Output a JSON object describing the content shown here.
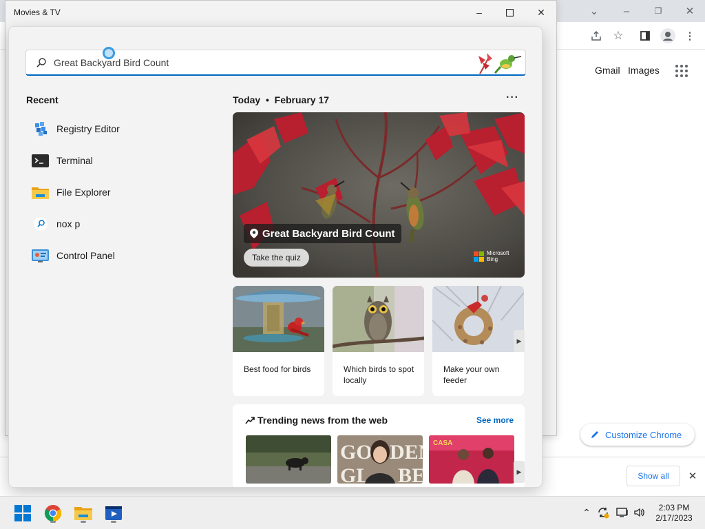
{
  "window": {
    "title": "Movies & TV"
  },
  "chrome": {
    "gmail": "Gmail",
    "images": "Images",
    "customize": "Customize Chrome",
    "show_all": "Show all"
  },
  "search": {
    "query": "Great Backyard Bird Count"
  },
  "recent": {
    "heading": "Recent",
    "items": [
      {
        "label": "Registry Editor",
        "icon": "registry-editor-icon"
      },
      {
        "label": "Terminal",
        "icon": "terminal-icon"
      },
      {
        "label": "File Explorer",
        "icon": "folder-icon"
      },
      {
        "label": "nox p",
        "icon": "search-icon"
      },
      {
        "label": "Control Panel",
        "icon": "control-panel-icon"
      }
    ]
  },
  "today": {
    "label": "Today",
    "date": "February 17"
  },
  "hero": {
    "title": "Great Backyard Bird Count",
    "button": "Take the quiz",
    "brand_line1": "Microsoft",
    "brand_line2": "Bing"
  },
  "cards": [
    {
      "label": "Best food for birds"
    },
    {
      "label": "Which birds to spot locally"
    },
    {
      "label": "Make your own feeder"
    }
  ],
  "trending": {
    "heading": "Trending news from the web",
    "see_more": "See more"
  },
  "clock": {
    "time": "2:03 PM",
    "date": "2/17/2023"
  },
  "colors": {
    "accent": "#0067c0",
    "chrome_blue": "#1a73e8"
  }
}
